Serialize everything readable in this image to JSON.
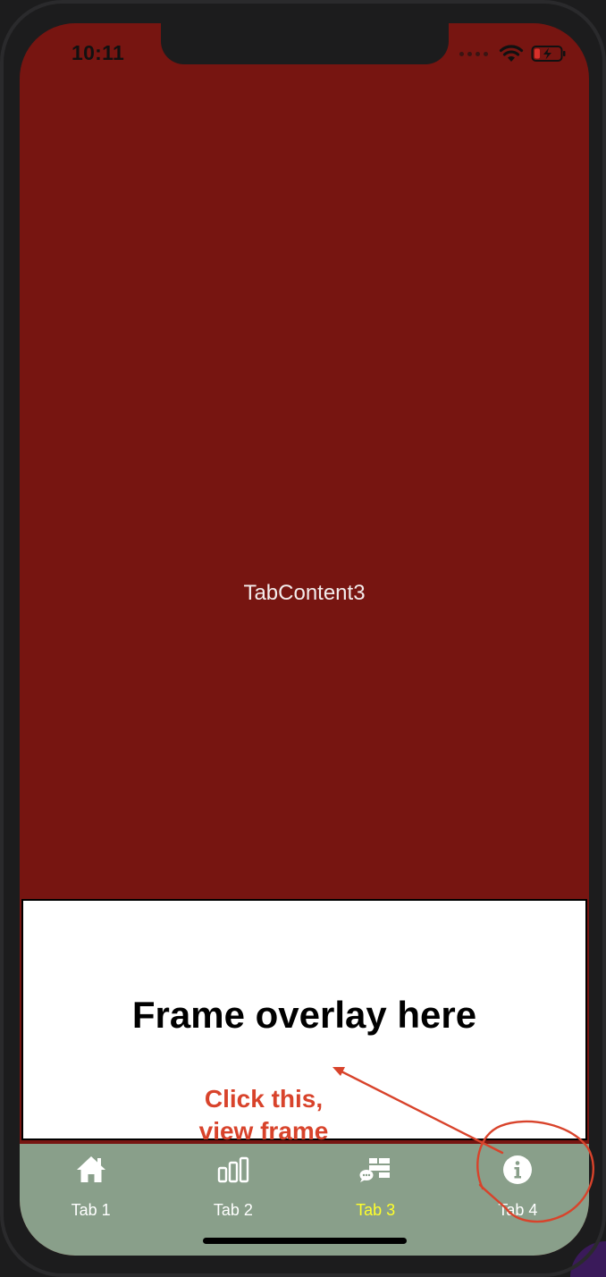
{
  "status_bar": {
    "time": "10:11"
  },
  "content": {
    "tab_content_label": "TabContent3"
  },
  "overlay": {
    "text": "Frame overlay here"
  },
  "annotation": {
    "line1": "Click this,",
    "line2": "view frame",
    "color": "#d8432b"
  },
  "tab_bar": {
    "background": "#899f8a",
    "active_color": "#ffff2a",
    "tabs": [
      {
        "label": "Tab 1",
        "icon": "home-icon"
      },
      {
        "label": "Tab 2",
        "icon": "bar-chart-icon"
      },
      {
        "label": "Tab 3",
        "icon": "grid-chat-icon",
        "active": true
      },
      {
        "label": "Tab 4",
        "icon": "info-icon"
      }
    ]
  },
  "colors": {
    "screen_background": "#771511",
    "bezel": "#1c1c1d"
  }
}
